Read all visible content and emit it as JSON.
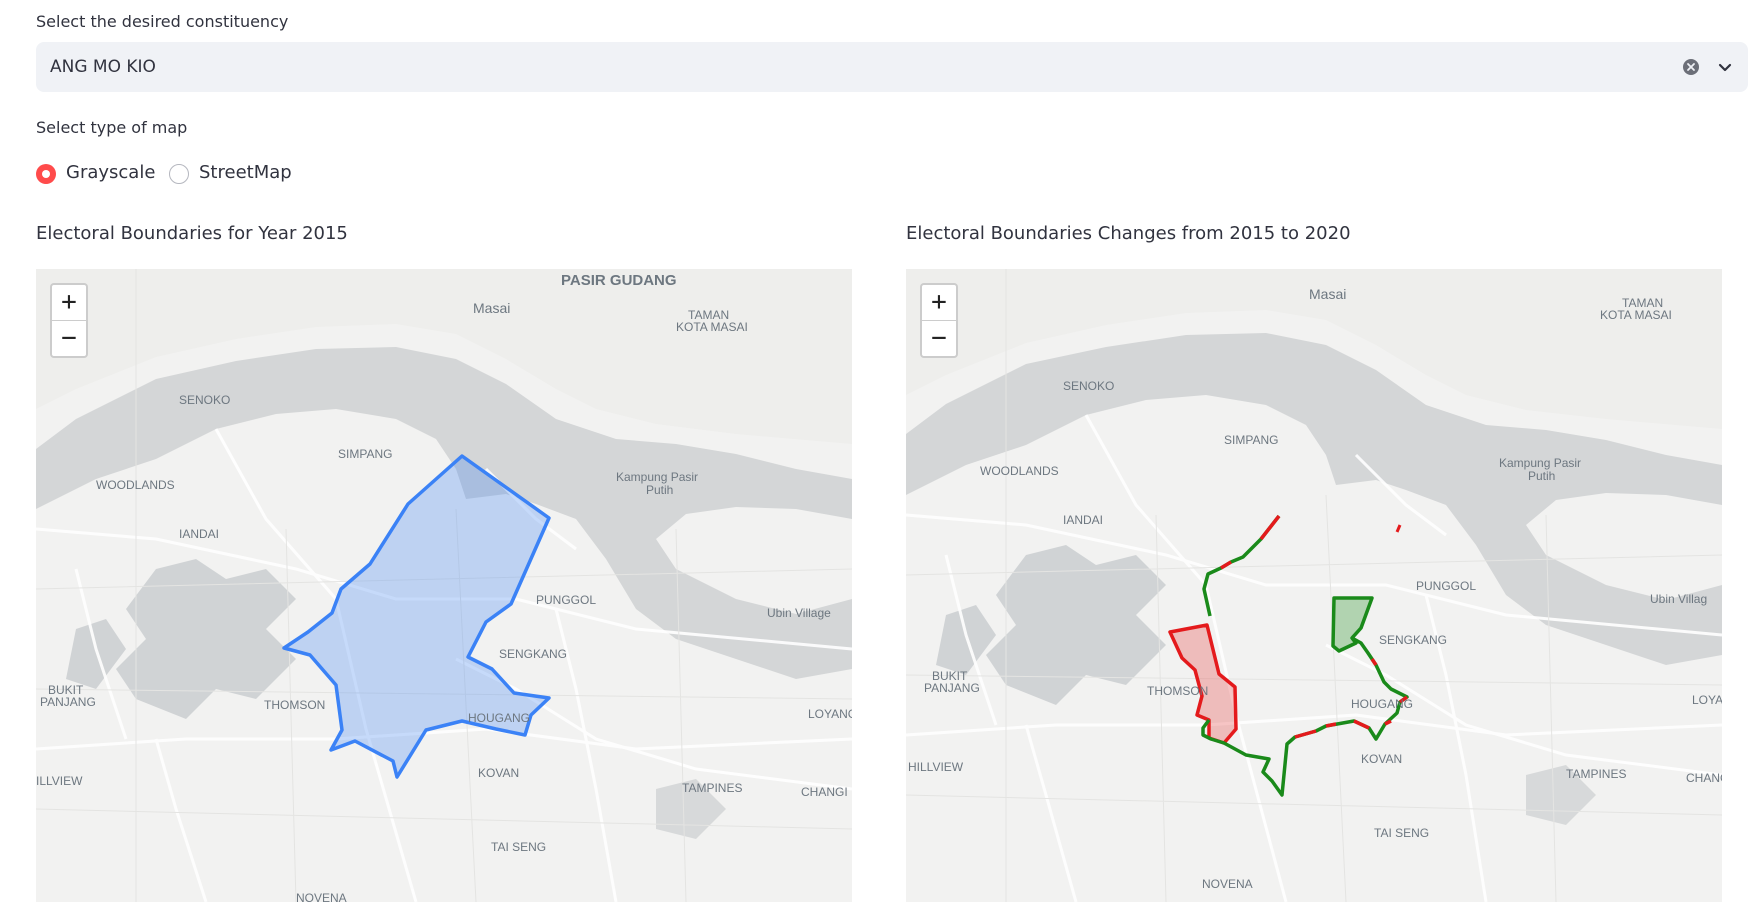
{
  "constituency": {
    "label": "Select the desired constituency",
    "value": "ANG MO KIO",
    "clear_icon": "clear-icon",
    "dropdown_icon": "chevron-down-icon"
  },
  "map_type": {
    "label": "Select type of map",
    "options": [
      "Grayscale",
      "StreetMap"
    ],
    "selected": "Grayscale",
    "selected_color": "#ff4b4b"
  },
  "map_left": {
    "title": "Electoral Boundaries for Year 2015",
    "zoom_in": "+",
    "zoom_out": "−",
    "boundary_color": "#3b82f6",
    "places": [
      "PASIR GUDANG",
      "Masai",
      "TAMAN",
      "KOTA MASAI",
      "SENOKO",
      "SIMPANG",
      "WOODLANDS",
      "Kampung Pasir",
      "Putih",
      "IANDAI",
      "PUNGGOL",
      "Ubin Village",
      "SENGKANG",
      "BUKIT",
      "PANJANG",
      "THOMSON",
      "HOUGANG",
      "LOYANG",
      "ILLVIEW",
      "KOVAN",
      "TAMPINES",
      "CHANGI",
      "TAI SENG",
      "NOVENA"
    ]
  },
  "map_right": {
    "title": "Electoral Boundaries Changes from 2015 to 2020",
    "zoom_in": "+",
    "zoom_out": "−",
    "removed_color": "#e41a1c",
    "added_color": "#1a8a1a",
    "places": [
      "Masai",
      "TAMAN",
      "KOTA MASAI",
      "SENOKO",
      "SIMPANG",
      "WOODLANDS",
      "Kampung Pasir",
      "Putih",
      "IANDAI",
      "PUNGGOL",
      "Ubin Villag",
      "SENGKANG",
      "BUKIT",
      "PANJANG",
      "THOMSON",
      "HOUGANG",
      "LOYA",
      "HILLVIEW",
      "KOVAN",
      "TAMPINES",
      "CHANG",
      "TAI SENG",
      "NOVENA"
    ]
  }
}
